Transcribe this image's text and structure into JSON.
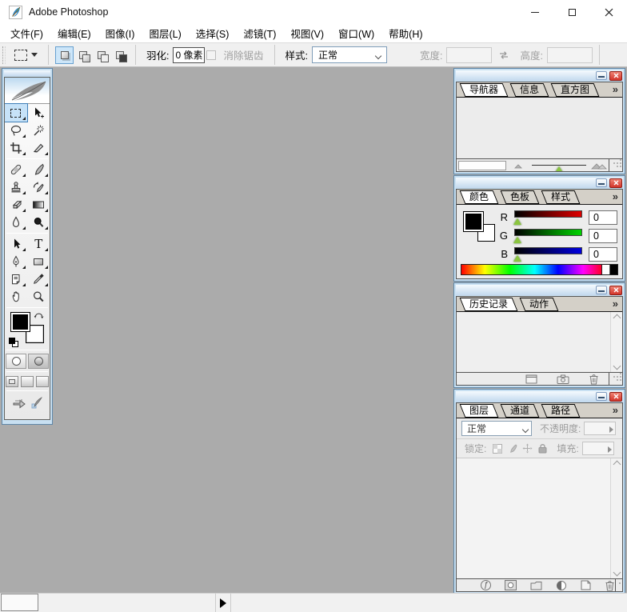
{
  "window": {
    "title": "Adobe Photoshop"
  },
  "menu": {
    "items": [
      {
        "label": "文件(F)"
      },
      {
        "label": "编辑(E)"
      },
      {
        "label": "图像(I)"
      },
      {
        "label": "图层(L)"
      },
      {
        "label": "选择(S)"
      },
      {
        "label": "滤镜(T)"
      },
      {
        "label": "视图(V)"
      },
      {
        "label": "窗口(W)"
      },
      {
        "label": "帮助(H)"
      }
    ]
  },
  "options": {
    "feather_label": "羽化:",
    "feather_value": "0 像素",
    "antialias_label": "消除锯齿",
    "style_label": "样式:",
    "style_value": "正常",
    "width_label": "宽度:",
    "width_value": "",
    "height_label": "高度:",
    "height_value": ""
  },
  "toolbox": {
    "selected_tool": "rectangular-marquee",
    "tools": [
      "rectangular-marquee",
      "move",
      "lasso",
      "magic-wand",
      "crop",
      "slice",
      "healing-brush",
      "brush",
      "clone-stamp",
      "history-brush",
      "eraser",
      "gradient",
      "blur",
      "dodge",
      "path-selection",
      "type",
      "pen",
      "shape",
      "notes",
      "eyedropper",
      "hand",
      "zoom"
    ]
  },
  "icons": {
    "type_glyph": "T",
    "fx_glyph": "ƒ"
  },
  "panels": {
    "navigator": {
      "tabs": [
        {
          "label": "导航器"
        },
        {
          "label": "信息"
        },
        {
          "label": "直方图"
        }
      ],
      "zoom_value": "",
      "more": "»"
    },
    "color": {
      "tabs": [
        {
          "label": "颜色"
        },
        {
          "label": "色板"
        },
        {
          "label": "样式"
        }
      ],
      "channels": [
        {
          "label": "R",
          "value": "0"
        },
        {
          "label": "G",
          "value": "0"
        },
        {
          "label": "B",
          "value": "0"
        }
      ],
      "more": "»"
    },
    "history": {
      "tabs": [
        {
          "label": "历史记录"
        },
        {
          "label": "动作"
        }
      ],
      "more": "»"
    },
    "layers": {
      "tabs": [
        {
          "label": "图层"
        },
        {
          "label": "通道"
        },
        {
          "label": "路径"
        }
      ],
      "blend_mode": "正常",
      "opacity_label": "不透明度:",
      "opacity_value": "",
      "lock_label": "锁定:",
      "fill_label": "填充:",
      "fill_value": "",
      "more": "»"
    }
  },
  "status": {
    "zoom_value": "",
    "doc_info": ""
  }
}
